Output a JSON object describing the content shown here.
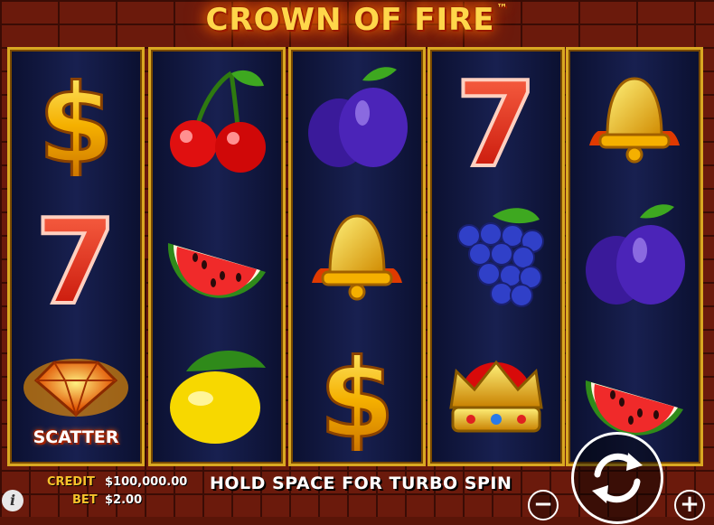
{
  "game": {
    "title": "CROWN OF FIRE",
    "trademark": "™",
    "turbo_hint": "HOLD SPACE FOR TURBO SPIN",
    "scatter_label": "SCATTER"
  },
  "reels": [
    [
      "dollar",
      "seven",
      "scatter"
    ],
    [
      "cherries",
      "watermelon",
      "lemon"
    ],
    [
      "plum",
      "bell",
      "dollar"
    ],
    [
      "seven",
      "grapes",
      "crown"
    ],
    [
      "bell",
      "plum",
      "watermelon"
    ]
  ],
  "account": {
    "credit_label": "CREDIT",
    "credit_value": "$100,000.00",
    "bet_label": "BET",
    "bet_value": "$2.00"
  },
  "controls": {
    "info_icon": "i",
    "minus_label": "−",
    "plus_label": "+",
    "spin_icon": "refresh-arrows-icon"
  },
  "colors": {
    "gold": "#f7c32c",
    "reel_bg": "#182050",
    "brick": "#6b1a0c"
  }
}
